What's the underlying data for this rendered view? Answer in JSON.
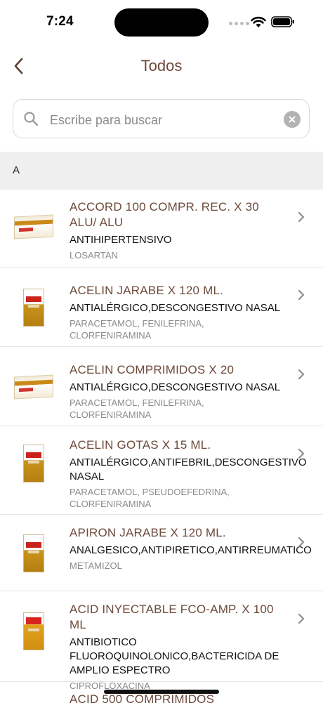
{
  "status": {
    "time": "7:24"
  },
  "nav": {
    "title": "Todos"
  },
  "search": {
    "placeholder": "Escribe para buscar",
    "value": ""
  },
  "section": {
    "letter": "A"
  },
  "items": [
    {
      "name": "ACCORD 100 COMPR. REC. X 30 ALU/ ALU",
      "classification": "ANTIHIPERTENSIVO",
      "active": "LOSARTAN"
    },
    {
      "name": "ACELIN JARABE X 120 ML.",
      "classification": "ANTIALÉRGICO,DESCONGESTIVO NASAL",
      "active": "PARACETAMOL, FENILEFRINA, CLORFENIRAMINA"
    },
    {
      "name": "ACELIN COMPRIMIDOS X 20",
      "classification": "ANTIALÉRGICO,DESCONGESTIVO NASAL",
      "active": "PARACETAMOL, FENILEFRINA, CLORFENIRAMINA"
    },
    {
      "name": "ACELIN GOTAS X 15 ML.",
      "classification": "ANTIALÉRGICO,ANTIFEBRIL,DESCONGESTIVO NASAL",
      "active": "PARACETAMOL, PSEUDOEFEDRINA, CLORFENIRAMINA"
    },
    {
      "name": "APIRON JARABE X 120 ML.",
      "classification": "ANALGESICO,ANTIPIRETICO,ANTIRREUMATICO",
      "active": "METAMIZOL"
    },
    {
      "name": "ACID INYECTABLE FCO-AMP. X 100 ML",
      "classification": "ANTIBIOTICO FLUOROQUINOLONICO,BACTERICIDA DE AMPLIO ESPECTRO",
      "active": "CIPROFLOXACINA"
    },
    {
      "name": "ACID 500 COMPRIMIDOS",
      "classification": "",
      "active": ""
    }
  ]
}
